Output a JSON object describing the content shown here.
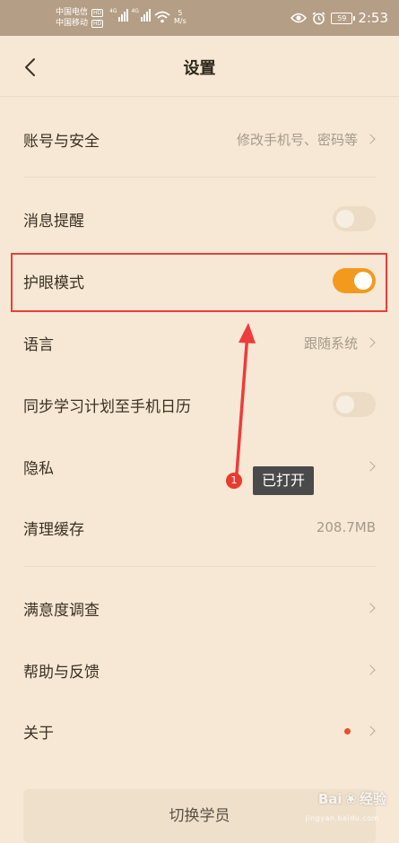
{
  "status_bar": {
    "carrier_1": "中国电信",
    "carrier_2": "中国移动",
    "hd_badge": "HD",
    "signal_label": "4G",
    "net_speed_value": "5",
    "net_speed_unit": "M/s",
    "battery": "59",
    "time": "2:53"
  },
  "header": {
    "title": "设置"
  },
  "rows": [
    {
      "label": "账号与安全",
      "value": "修改手机号、密码等"
    },
    {
      "label": "消息提醒",
      "toggle": "off"
    },
    {
      "label": "护眼模式",
      "toggle": "on"
    },
    {
      "label": "语言",
      "value": "跟随系统"
    },
    {
      "label": "同步学习计划至手机日历",
      "toggle": "off"
    },
    {
      "label": "隐私"
    },
    {
      "label": "清理缓存",
      "value": "208.7MB"
    },
    {
      "label": "满意度调查"
    },
    {
      "label": "帮助与反馈"
    },
    {
      "label": "关于"
    }
  ],
  "bottom_button": {
    "label": "切换学员"
  },
  "annotation": {
    "number": "1",
    "text": "已打开"
  },
  "watermark": {
    "brand": "Bai",
    "brand2": "经验",
    "sub": "jingyan.baidu.com"
  },
  "colors": {
    "background": "#f6e8d4",
    "status_bar": "#b49e85",
    "toggle_on": "#f39a1e",
    "highlight": "#ee3b3b"
  }
}
